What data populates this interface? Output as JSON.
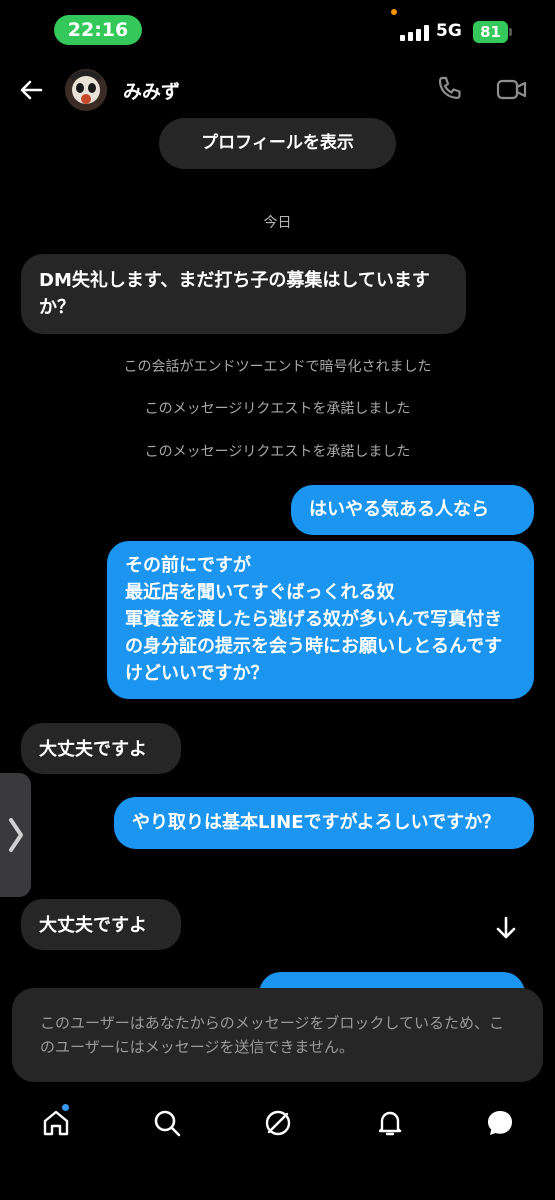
{
  "status_bar": {
    "time": "22:16",
    "network": "5G",
    "battery": "81"
  },
  "header": {
    "username": "みみず"
  },
  "profile_button": {
    "label": "プロフィールを表示"
  },
  "date_separator": "今日",
  "messages": [
    {
      "side": "in",
      "text": "DM失礼します、まだ打ち子の募集はしていますか？"
    },
    {
      "side": "out",
      "text": "はいやる気ある人なら"
    },
    {
      "side": "out",
      "text": "その前にですが\n最近店を聞いてすぐばっくれる奴\n軍資金を渡したら逃げる奴が多いんで写真付きの身分証の提示を会う時にお願いしとるんですけどいいですか？"
    },
    {
      "side": "in",
      "text": "大丈夫ですよ"
    },
    {
      "side": "out",
      "text": "やり取りは基本LINEですがよろしいですか？"
    },
    {
      "side": "in",
      "text": "大丈夫ですよ"
    }
  ],
  "system_messages": [
    "この会話がエンドツーエンドで暗号化されました",
    "このメッセージリクエストを承諾しました",
    "このメッセージリクエストを承諾しました"
  ],
  "blocked_notice": "このユーザーはあなたからのメッセージをブロックしているため、このユーザーにはメッセージを送信できません。",
  "icons": {
    "back": "back-arrow-icon",
    "call": "phone-icon",
    "video": "video-camera-icon",
    "scroll": "arrow-down-icon",
    "nav": [
      "home-icon",
      "search-icon",
      "explore-icon",
      "notifications-icon",
      "messages-icon"
    ]
  },
  "colors": {
    "outgoing": "#1c95f0",
    "incoming": "#262626",
    "status_green": "#34c759"
  }
}
